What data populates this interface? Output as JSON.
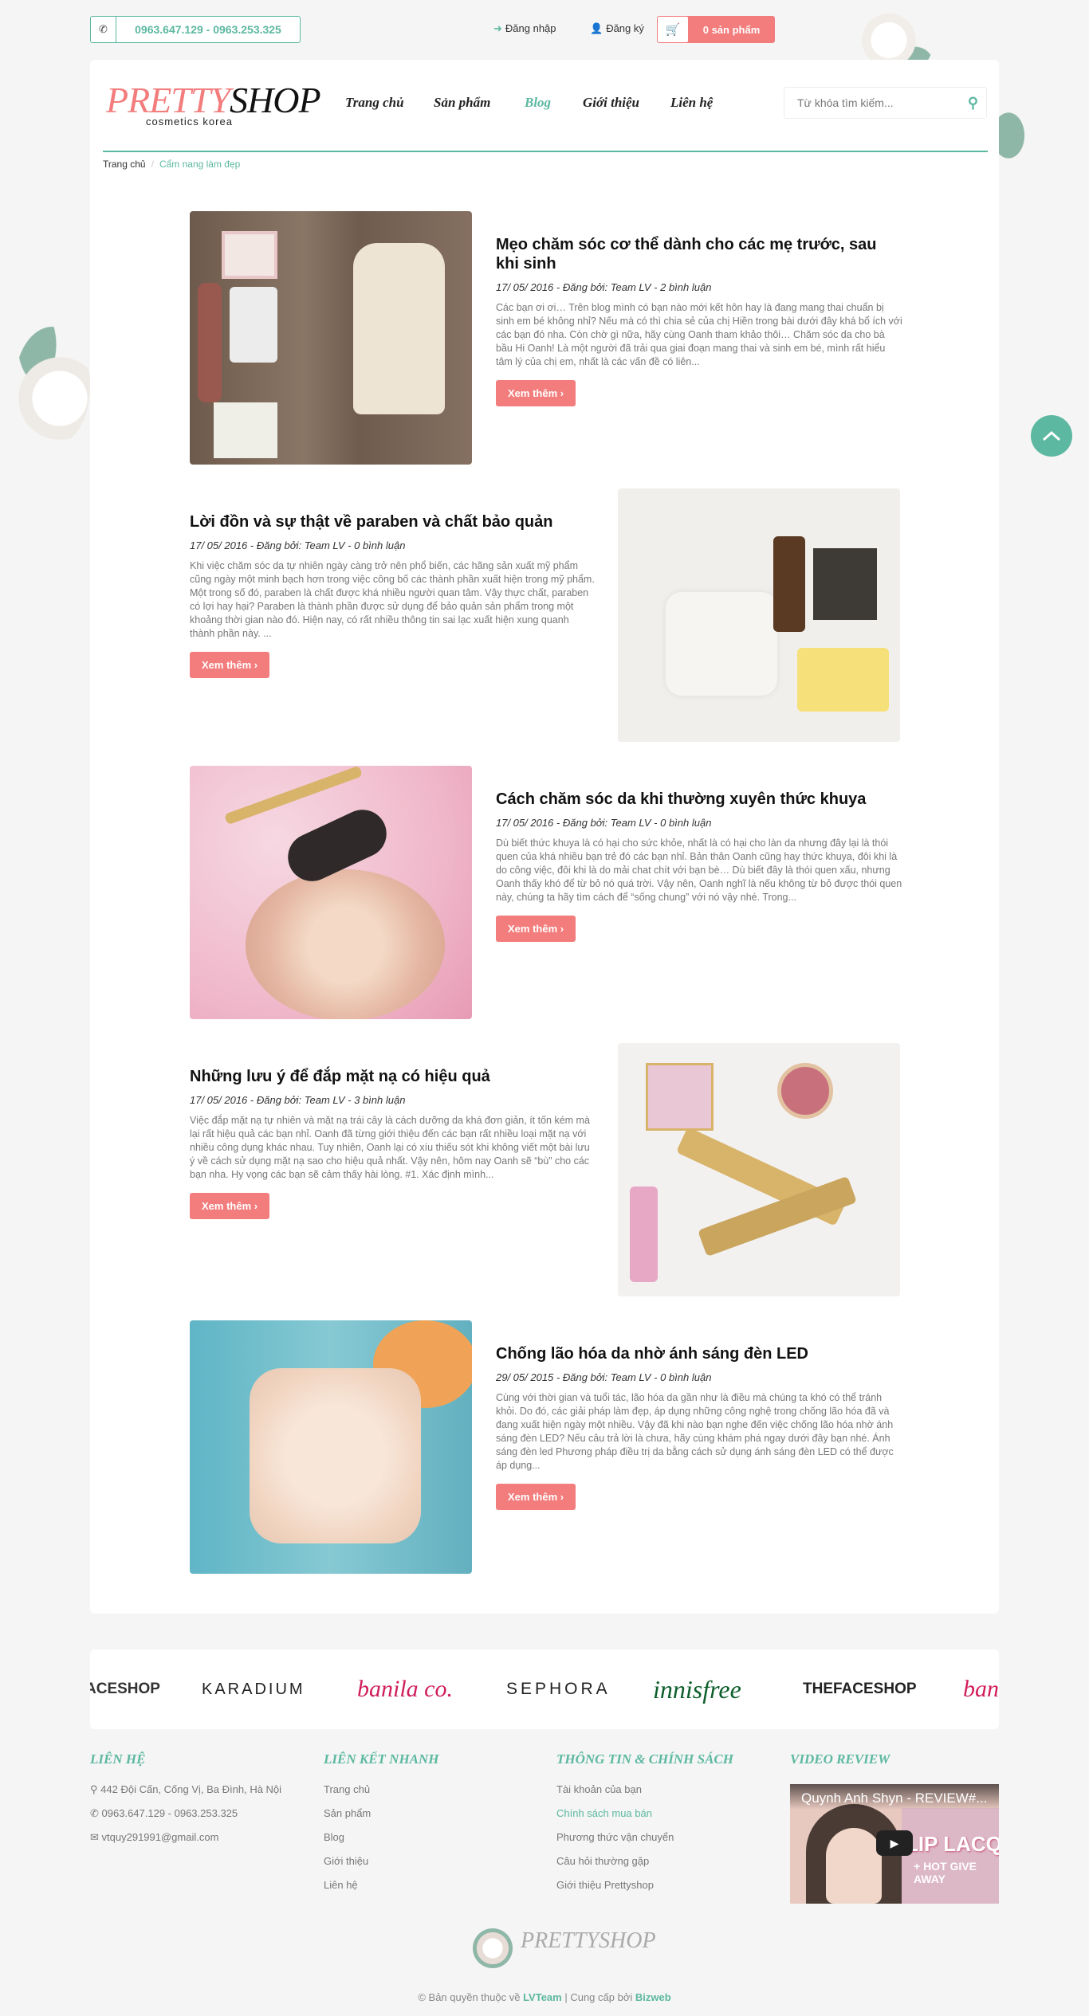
{
  "topbar": {
    "phone": "0963.647.129 - 0963.253.325",
    "login": "Đăng nhập",
    "register": "Đăng ký",
    "cart": "0 sản phẩm"
  },
  "logo": {
    "part1": "PRETTY",
    "part2": "SHOP",
    "tagline": "cosmetics korea"
  },
  "nav": [
    "Trang chủ",
    "Sản phẩm",
    "Blog",
    "Giới thiệu",
    "Liên hệ"
  ],
  "search": {
    "placeholder": "Từ khóa tìm kiếm..."
  },
  "breadcrumb": {
    "home": "Trang chủ",
    "sep": "/",
    "current": "Cẩm nang làm đẹp"
  },
  "posts": [
    {
      "title": "Mẹo chăm sóc cơ thể dành cho các mẹ trước, sau khi sinh",
      "meta": "17/ 05/ 2016 - Đăng bởi: Team LV - 2 bình luận",
      "excerpt": "Các bạn ơi ơi… Trên blog mình có bạn nào mới kết hôn hay là đang mang thai chuẩn bị sinh em bé không nhỉ? Nếu mà có thì chia sẻ của chị Hiền trong bài dưới đây khá bổ ích với các bạn đó nha. Còn chờ gì nữa, hãy cùng Oanh tham khảo thôi… Chăm sóc da cho bà bầu Hi Oanh! Là một người đã trải qua giai đoạn mang thai và sinh em bé, mình rất hiểu tâm lý của chị em, nhất là các vấn đề có liên...",
      "button": "Xem thêm"
    },
    {
      "title": "Lời đồn và sự thật về paraben và chất bảo quản",
      "meta": "17/ 05/ 2016 - Đăng bởi: Team LV - 0 bình luận",
      "excerpt": "Khi việc chăm sóc da tự nhiên ngày càng trở nên phổ biến, các hãng sản xuất mỹ phẩm cũng ngày một minh bạch hơn trong việc công bố các thành phần xuất hiện trong mỹ phẩm. Một trong số đó, paraben là chất được khá nhiều người quan tâm. Vậy thực chất, paraben có lợi hay hại? Paraben là thành phần được sử dụng để bảo quản sản phẩm trong một khoảng thời gian nào đó. Hiện nay, có rất nhiều thông tin sai lạc xuất hiện xung quanh thành phần này. ...",
      "button": "Xem thêm"
    },
    {
      "title": "Cách chăm sóc da khi thường xuyên thức khuya",
      "meta": "17/ 05/ 2016 - Đăng bởi: Team LV - 0 bình luận",
      "excerpt": "Dù biết thức khuya là có hại cho sức khỏe, nhất là có hại cho làn da nhưng đây lại là thói quen của khá nhiều bạn trẻ đó các bạn nhỉ. Bản thân Oanh cũng hay thức khuya, đôi khi là do công việc, đôi khi là do mải chat chít với bạn bè… Dù biết đây là thói quen xấu, nhưng Oanh thấy khó để từ bỏ nó quá trời. Vậy nên, Oanh nghĩ là nếu không từ bỏ được thói quen này, chúng ta hãy tìm cách để “sống chung” với nó vậy nhé. Trong...",
      "button": "Xem thêm"
    },
    {
      "title": "Những lưu ý để đắp mặt nạ có hiệu quả",
      "meta": "17/ 05/ 2016 - Đăng bởi: Team LV - 3 bình luận",
      "excerpt": "Việc đắp mặt nạ tự nhiên và mặt nạ trái cây là cách dưỡng da khá đơn giản, ít tốn kém mà lại rất hiệu quả các bạn nhỉ. Oanh đã từng giới thiệu đến các bạn rất nhiều loại mặt nạ với nhiều công dụng khác nhau. Tuy nhiên, Oanh lại có xíu thiếu sót khi không viết một bài lưu ý về cách sử dụng mặt nạ sao cho hiệu quả nhất. Vậy nên, hôm nay Oanh sẽ “bù” cho các bạn nha. Hy vọng các bạn sẽ cảm thấy hài lòng. #1. Xác định mình...",
      "button": "Xem thêm"
    },
    {
      "title": "Chống lão hóa da nhờ ánh sáng đèn LED",
      "meta": "29/ 05/ 2015 - Đăng bởi: Team LV - 0 bình luận",
      "excerpt": "Cùng với thời gian và tuổi tác, lão hóa da gần như là điều mà chúng ta khó có thể tránh khỏi. Do đó, các giải pháp làm đẹp, áp dụng những công nghệ trong chống lão hóa đã và đang xuất hiện ngày một nhiều. Vậy đã khi nào bạn nghe đến việc chống lão hóa nhờ ánh sáng đèn LED? Nếu câu trả lời là chưa, hãy cùng khám phá ngay dưới đây bạn nhé. Ánh sáng đèn led Phương pháp điều trị da bằng cách sử dụng ánh sáng đèn LED có thể được áp dụng...",
      "button": "Xem thêm"
    }
  ],
  "brands": [
    "ACESHOP",
    "KARADIUM",
    "banila co.",
    "SEPHORA",
    "innisfree",
    "THEFACESHOP",
    "ban"
  ],
  "footer": {
    "contact": {
      "heading": "LIÊN HỆ",
      "address": "442 Đội Cấn, Cống Vị, Ba Đình, Hà Nội",
      "phone": "0963.647.129 - 0963.253.325",
      "email": "vtquy291991@gmail.com"
    },
    "quicklinks": {
      "heading": "LIÊN KẾT NHANH",
      "items": [
        "Trang chủ",
        "Sản phẩm",
        "Blog",
        "Giới thiệu",
        "Liên hệ"
      ]
    },
    "policy": {
      "heading": "THÔNG TIN & CHÍNH SÁCH",
      "items": [
        "Tài khoản của bạn",
        "Chính sách mua bán",
        "Phương thức vận chuyển",
        "Câu hỏi thường gặp",
        "Giới thiệu Prettyshop"
      ]
    },
    "video": {
      "heading": "VIDEO REVIEW",
      "title": "Quynh Anh Shyn - REVIEW#...",
      "overlay1": "LIP LACQUER",
      "overlay2": "+ HOT GIVE AWAY"
    },
    "logo": "PRETTYSHOP",
    "copyright": {
      "prefix": "© Bản quyền thuộc về ",
      "team": "LVTeam",
      "mid": " | Cung cấp bởi ",
      "provider": "Bizweb"
    }
  },
  "colors": {
    "accent": "#5cb8a0",
    "pink": "#f37c7c"
  }
}
